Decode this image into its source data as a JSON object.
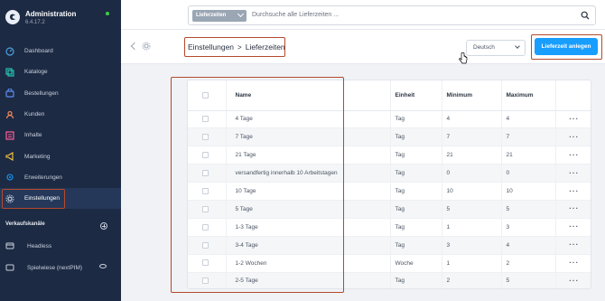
{
  "app": {
    "title": "Administration",
    "version": "6.4.17.2",
    "status_color": "#37d046"
  },
  "sidebar": {
    "items": [
      {
        "label": "Dashboard",
        "icon": "dashboard-icon"
      },
      {
        "label": "Kataloge",
        "icon": "catalog-icon"
      },
      {
        "label": "Bestellungen",
        "icon": "shopping-bag-icon"
      },
      {
        "label": "Kunden",
        "icon": "users-icon"
      },
      {
        "label": "Inhalte",
        "icon": "content-icon"
      },
      {
        "label": "Marketing",
        "icon": "megaphone-icon"
      },
      {
        "label": "Erweiterungen",
        "icon": "plugin-icon"
      },
      {
        "label": "Einstellungen",
        "icon": "gear-icon",
        "active": true
      }
    ],
    "sales_channels_heading": "Verkaufskanäle",
    "channels": [
      {
        "label": "Headless",
        "icon": "headless-icon"
      },
      {
        "label": "Spielwiese (nextPIM)",
        "icon": "storefront-icon"
      }
    ]
  },
  "search": {
    "type_label": "Lieferzeiten",
    "placeholder": "Durchsuche alle Lieferzeiten ..."
  },
  "header": {
    "breadcrumb_parent": "Einstellungen",
    "breadcrumb_separator": ">",
    "breadcrumb_current": "Lieferzeiten",
    "language": "Deutsch",
    "add_button": "Lieferzeit anlegen"
  },
  "table": {
    "columns": [
      "Name",
      "Einheit",
      "Minimum",
      "Maximum"
    ],
    "rows": [
      {
        "name": "4 Tage",
        "unit": "Tag",
        "min": "4",
        "max": "4"
      },
      {
        "name": "7 Tage",
        "unit": "Tag",
        "min": "7",
        "max": "7"
      },
      {
        "name": "21 Tage",
        "unit": "Tag",
        "min": "21",
        "max": "21"
      },
      {
        "name": "versandfertig innerhalb 10 Arbeitstagen",
        "unit": "Tag",
        "min": "0",
        "max": "0"
      },
      {
        "name": "10 Tage",
        "unit": "Tag",
        "min": "10",
        "max": "10"
      },
      {
        "name": "5 Tage",
        "unit": "Tag",
        "min": "5",
        "max": "5"
      },
      {
        "name": "1-3 Tage",
        "unit": "Tag",
        "min": "1",
        "max": "3"
      },
      {
        "name": "3-4 Tage",
        "unit": "Tag",
        "min": "3",
        "max": "4"
      },
      {
        "name": "1-2 Wochen",
        "unit": "Woche",
        "min": "1",
        "max": "2"
      },
      {
        "name": "2-5 Tage",
        "unit": "Tag",
        "min": "2",
        "max": "5"
      }
    ],
    "row_action_label": "···"
  },
  "colors": {
    "sidebar_bg": "#1d2a43",
    "primary": "#189eff",
    "highlight_outline": "#b34a2c"
  }
}
